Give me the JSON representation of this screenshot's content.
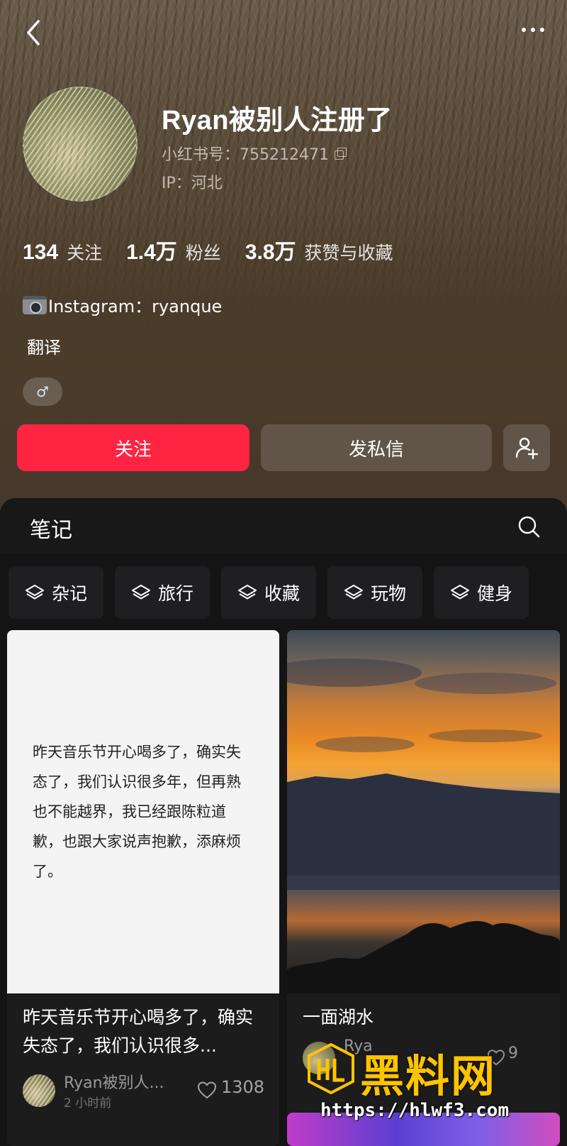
{
  "profile": {
    "name": "Ryan被别人注册了",
    "red_id": "小红书号：755212471",
    "ip": "IP：河北",
    "bio_line1": "Instagram：ryanque",
    "bio_line2": "翻译",
    "gender_symbol": "♂"
  },
  "stats": [
    {
      "num": "134",
      "label": "关注"
    },
    {
      "num": "1.4万",
      "label": "粉丝"
    },
    {
      "num": "3.8万",
      "label": "获赞与收藏"
    }
  ],
  "actions": {
    "follow": "关注",
    "message": "发私信"
  },
  "tabs": {
    "notes": "笔记"
  },
  "collections": [
    {
      "label": "杂记"
    },
    {
      "label": "旅行"
    },
    {
      "label": "收藏"
    },
    {
      "label": "玩物"
    },
    {
      "label": "健身"
    }
  ],
  "notes": [
    {
      "image_text": "昨天音乐节开心喝多了，确实失态了，我们认识很多年，但再熟也不能越界，我已经跟陈粒道歉，也跟大家说声抱歉，添麻烦了。",
      "title": "昨天音乐节开心喝多了，确实失态了，我们认识很多...",
      "user": "Ryan被别人...",
      "time": "2 小时前",
      "likes": "1308"
    },
    {
      "title": "一面湖水",
      "user": "Rya",
      "likes": "9"
    }
  ],
  "watermark": {
    "brand": "黑料网",
    "url": "https://hlwf3.com"
  },
  "colors": {
    "accent": "#ff2442",
    "watermark": "#ffc400"
  }
}
